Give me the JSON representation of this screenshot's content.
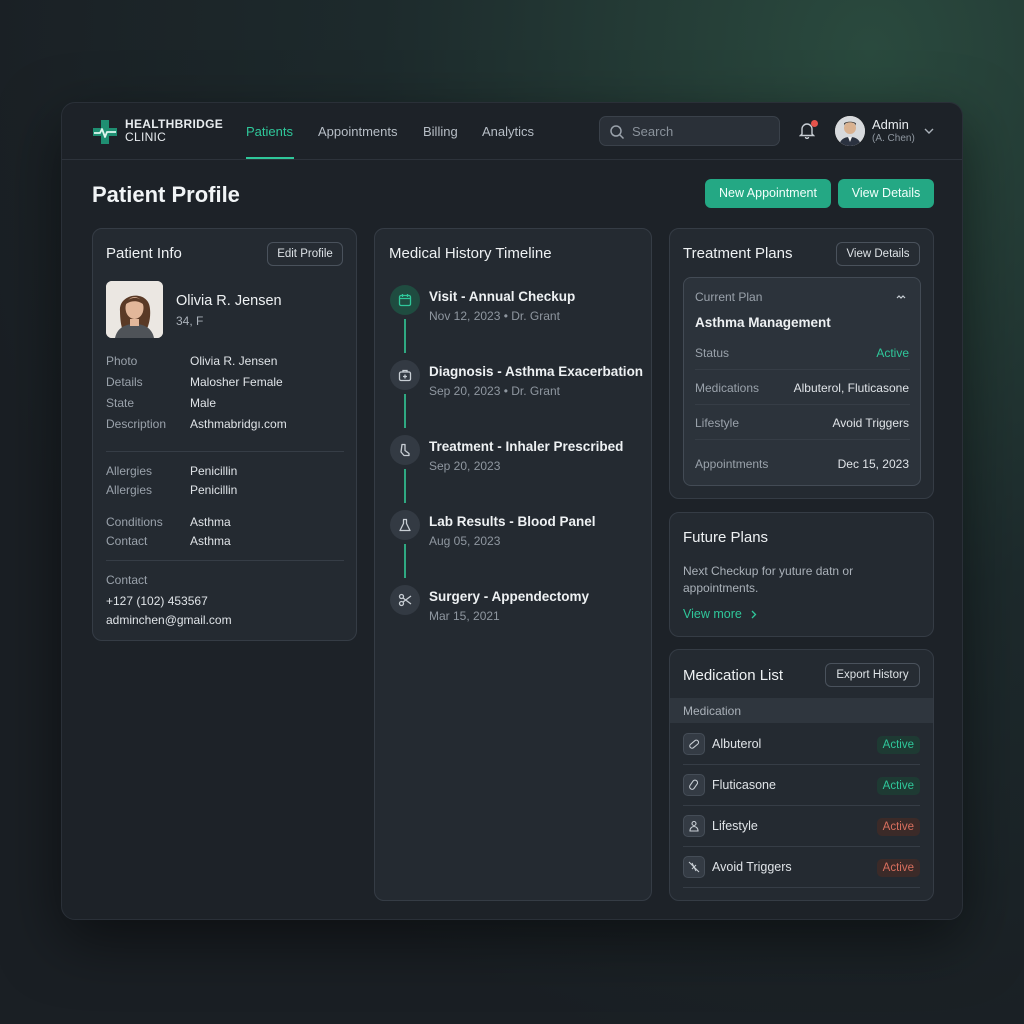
{
  "brand": {
    "line1": "HEALTHBRIDGE",
    "line2": "CLINIC"
  },
  "nav": {
    "patients": "Patients",
    "appointments": "Appointments",
    "billing": "Billing",
    "analytics": "Analytics"
  },
  "search": {
    "placeholder": "Search"
  },
  "user": {
    "name": "Admin",
    "role": "(A. Chen)"
  },
  "page": {
    "title": "Patient Profile",
    "new_appointment": "New Appointment",
    "view_details": "View Details"
  },
  "patient_info": {
    "title": "Patient Info",
    "edit": "Edit Profile",
    "name": "Olivia R. Jensen",
    "age_sex": "34, F",
    "fields": [
      {
        "label": "Photo",
        "value": "Olivia R. Jensen"
      },
      {
        "label": "Details",
        "value": "Malosher Female"
      },
      {
        "label": "State",
        "value": "Male"
      },
      {
        "label": "Description",
        "value": "Asthmabridgı.com"
      }
    ],
    "fields2": [
      {
        "label": "Allergies",
        "value": "Penicillin"
      },
      {
        "label": "Allergies",
        "value": "Penicillin"
      }
    ],
    "fields3": [
      {
        "label": "Conditions",
        "value": "Asthma"
      },
      {
        "label": "Contact",
        "value": "Asthma"
      }
    ],
    "contact_label": "Contact",
    "phone": "+127 (102) 453567",
    "email": "adminchen@gmail.com"
  },
  "timeline": {
    "title": "Medical History Timeline",
    "items": [
      {
        "title": "Visit - Annual Checkup",
        "sub": "Nov 12, 2023 • Dr. Grant",
        "icon": "calendar-icon"
      },
      {
        "title": "Diagnosis - Asthma Exacerbation",
        "sub": "Sep 20, 2023 • Dr. Grant",
        "icon": "medical-bag-icon"
      },
      {
        "title": "Treatment - Inhaler Prescribed",
        "sub": "Sep 20, 2023",
        "icon": "inhaler-icon"
      },
      {
        "title": "Lab Results - Blood Panel",
        "sub": "Aug 05, 2023",
        "icon": "flask-icon"
      },
      {
        "title": "Surgery - Appendectomy",
        "sub": "Mar 15, 2021",
        "icon": "scissors-icon"
      }
    ]
  },
  "treatment": {
    "title": "Treatment Plans",
    "view": "View Details",
    "current_label": "Current Plan",
    "current_plan": "Asthma Management",
    "rows": [
      {
        "label": "Status",
        "value": "Active"
      },
      {
        "label": "Medications",
        "value": "Albuterol, Fluticasone"
      },
      {
        "label": "Lifestyle",
        "value": "Avoid Triggers"
      },
      {
        "label": "Appointments",
        "value": "Dec 15, 2023"
      }
    ]
  },
  "future": {
    "title": "Future Plans",
    "text": "Next Checkup for yuture datn or appointments.",
    "link": "View more"
  },
  "medlist": {
    "title": "Medication List",
    "export": "Export History",
    "header": "Medication",
    "items": [
      {
        "name": "Albuterol",
        "status": "Active",
        "tone": "green",
        "icon": "pill-icon"
      },
      {
        "name": "Fluticasone",
        "status": "Active",
        "tone": "green",
        "icon": "inhaler-icon"
      },
      {
        "name": "Lifestyle",
        "status": "Active",
        "tone": "red",
        "icon": "person-icon"
      },
      {
        "name": "Avoid Triggers",
        "status": "Active",
        "tone": "red",
        "icon": "no-trigger-icon"
      }
    ]
  },
  "colors": {
    "accent": "#2fc79a",
    "button": "#24a884",
    "alert": "#e5534b"
  }
}
